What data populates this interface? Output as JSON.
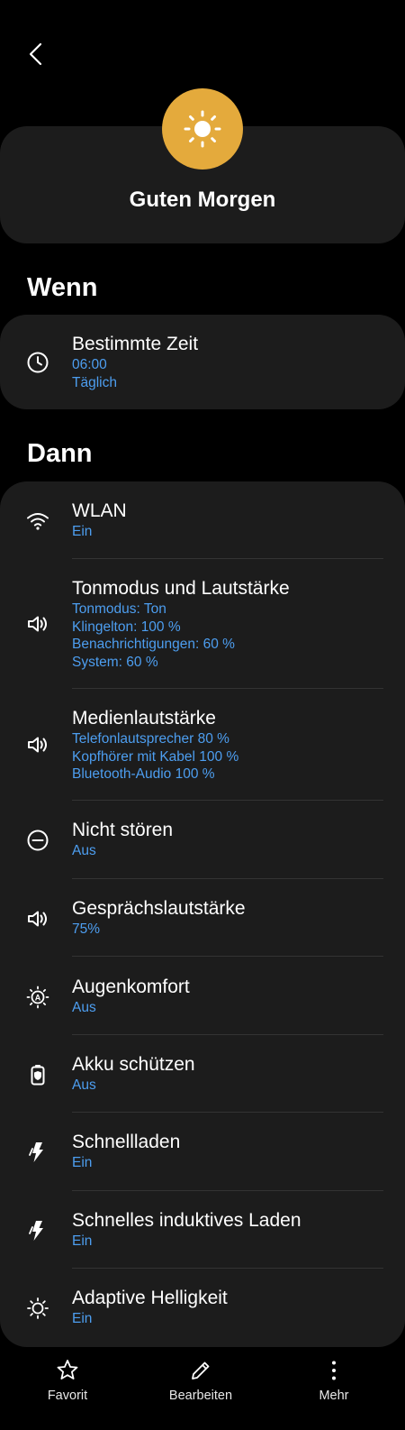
{
  "header": {
    "title": "Guten Morgen",
    "icon": "sun-icon",
    "icon_color": "#e4aa3c"
  },
  "sections": {
    "if_title": "Wenn",
    "then_title": "Dann"
  },
  "condition": {
    "icon": "clock-icon",
    "label": "Bestimmte Zeit",
    "sub": [
      "06:00",
      "Täglich"
    ]
  },
  "actions": [
    {
      "icon": "wifi-icon",
      "label": "WLAN",
      "sub": [
        "Ein"
      ]
    },
    {
      "icon": "speaker-icon",
      "label": "Tonmodus und Lautstärke",
      "sub": [
        "Tonmodus: Ton",
        "Klingelton: 100 %",
        "Benachrichtigungen: 60 %",
        "System: 60 %"
      ]
    },
    {
      "icon": "speaker-icon",
      "label": "Medienlautstärke",
      "sub": [
        "Telefonlautsprecher 80 %",
        "Kopfhörer mit Kabel 100 %",
        "Bluetooth-Audio 100 %"
      ]
    },
    {
      "icon": "do-not-disturb-icon",
      "label": "Nicht stören",
      "sub": [
        "Aus"
      ]
    },
    {
      "icon": "speaker-icon",
      "label": "Gesprächslautstärke",
      "sub": [
        "75%"
      ]
    },
    {
      "icon": "eye-comfort-icon",
      "label": "Augenkomfort",
      "sub": [
        "Aus"
      ]
    },
    {
      "icon": "battery-protect-icon",
      "label": "Akku schützen",
      "sub": [
        "Aus"
      ]
    },
    {
      "icon": "lightning-icon",
      "label": "Schnellladen",
      "sub": [
        "Ein"
      ]
    },
    {
      "icon": "lightning-icon",
      "label": "Schnelles induktives Laden",
      "sub": [
        "Ein"
      ]
    },
    {
      "icon": "brightness-icon",
      "label": "Adaptive Helligkeit",
      "sub": [
        "Ein"
      ]
    }
  ],
  "bottom_nav": [
    {
      "icon": "star-icon",
      "label": "Favorit"
    },
    {
      "icon": "pencil-icon",
      "label": "Bearbeiten"
    },
    {
      "icon": "more-vertical-icon",
      "label": "Mehr"
    }
  ],
  "colors": {
    "background": "#000000",
    "card": "#1c1c1c",
    "accent": "#4d9ef0",
    "sun": "#e4aa3c"
  }
}
